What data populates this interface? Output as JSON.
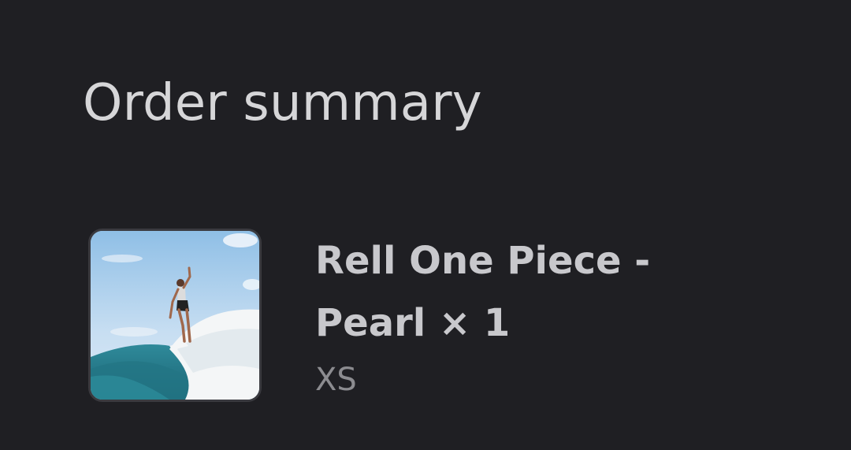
{
  "summary": {
    "title": "Order summary"
  },
  "item": {
    "name": "Rell One Piece - Pearl × 1",
    "variant": "XS",
    "image_subject": "surfer-photo"
  },
  "colors": {
    "background": "#1f1f23",
    "title_text": "#d6d6d8",
    "item_text": "#c8c8cc",
    "variant_text": "#8c8c90"
  }
}
